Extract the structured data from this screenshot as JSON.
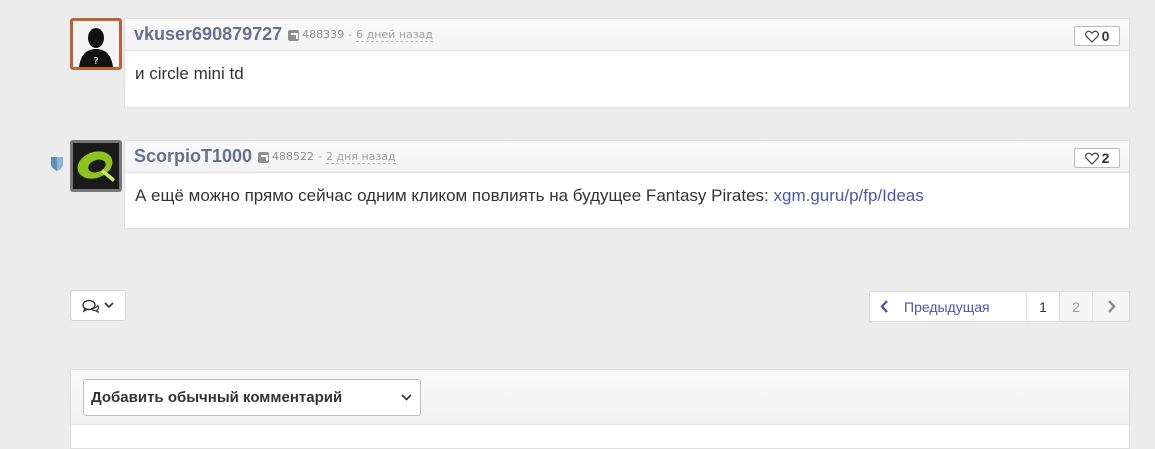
{
  "comments": [
    {
      "username": "vkuser690879727",
      "rep_id": "488339",
      "separator": "-",
      "time": "6 дней назад",
      "likes": "0",
      "text": "и circle mini td"
    },
    {
      "username": "ScorpioT1000",
      "rep_id": "488522",
      "separator": "-",
      "time": "2 дня назад",
      "likes": "2",
      "text": "А ещё можно прямо сейчас одним кликом повлиять на будущее Fantasy Pirates: ",
      "link": "xgm.guru/p/fp/Ideas"
    }
  ],
  "pagination": {
    "prev_label": "Предыдущая",
    "pages": [
      "1",
      "2"
    ]
  },
  "comment_form": {
    "type_select": "Добавить обычный комментарий"
  },
  "colors": {
    "username": "#67708c",
    "link": "#4a56a8",
    "background": "#ececec"
  }
}
